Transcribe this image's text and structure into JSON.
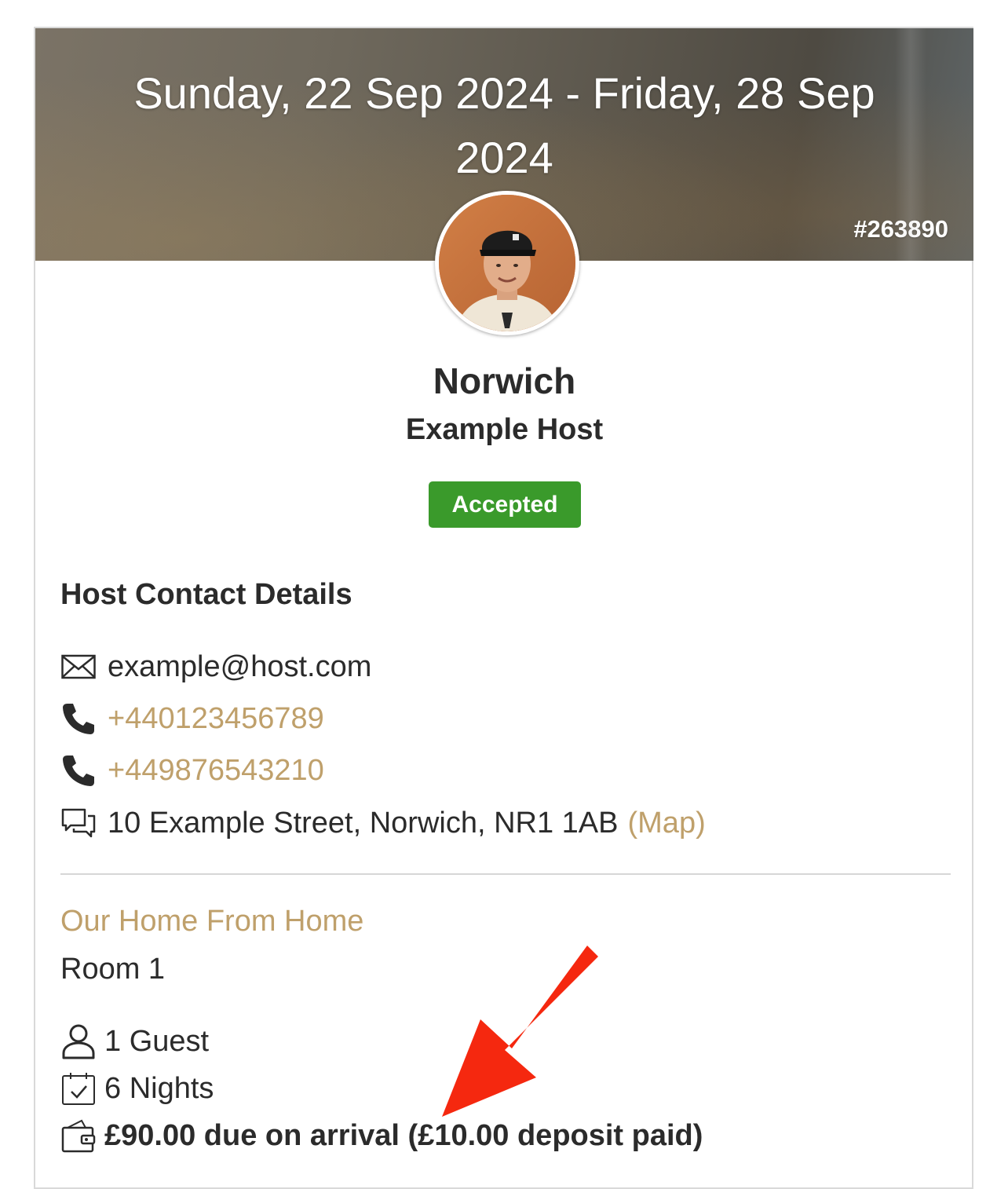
{
  "header": {
    "dates": "Sunday, 22 Sep 2024 - Friday, 28 Sep 2024",
    "booking_ref": "#263890"
  },
  "host": {
    "city": "Norwich",
    "name": "Example Host",
    "status": "Accepted",
    "status_color": "#3a9a2b"
  },
  "contact": {
    "section_title": "Host Contact Details",
    "email": "example@host.com",
    "phones": [
      "+440123456789",
      "+449876543210"
    ],
    "address": "10 Example Street, Norwich, NR1 1AB",
    "map_label": "(Map)",
    "link_color": "#bfa06b"
  },
  "listing": {
    "name": "Our Home From Home",
    "room": "Room 1",
    "guests": "1 Guest",
    "nights": "6 Nights",
    "payment": "£90.00 due on arrival (£10.00 deposit paid)"
  },
  "annotation": {
    "arrow_color": "#f5280f"
  }
}
